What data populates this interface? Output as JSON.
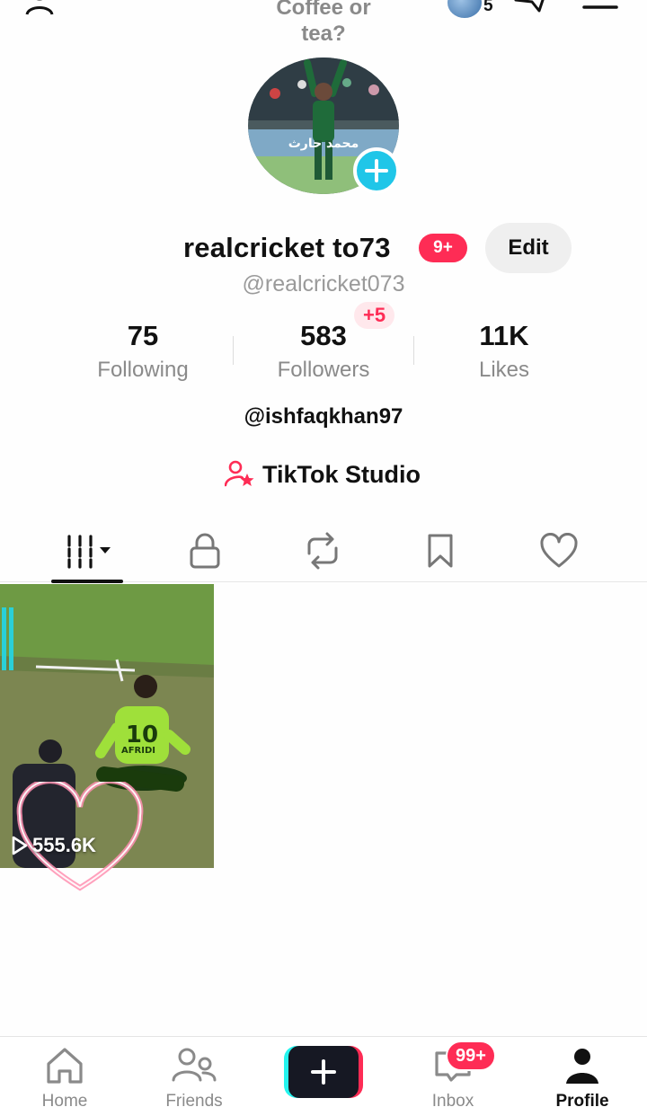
{
  "header": {
    "status_text": "Coffee or tea?",
    "story_count": "5"
  },
  "profile": {
    "display_name": "realcricket to73",
    "notification_badge": "9+",
    "edit_label": "Edit",
    "username": "@realcricket073",
    "avatar_caption": "محمد حارث"
  },
  "stats": {
    "following": {
      "value": "75",
      "label": "Following"
    },
    "followers": {
      "value": "583",
      "label": "Followers",
      "delta": "+5"
    },
    "likes": {
      "value": "11K",
      "label": "Likes"
    }
  },
  "bio": {
    "mention": "@ishfaqkhan97",
    "studio_label": "TikTok Studio"
  },
  "tabs": [
    {
      "icon": "grid-icon",
      "active": true
    },
    {
      "icon": "lock-icon",
      "active": false
    },
    {
      "icon": "repost-icon",
      "active": false
    },
    {
      "icon": "bookmark-icon",
      "active": false
    },
    {
      "icon": "heart-icon",
      "active": false
    }
  ],
  "videos": [
    {
      "views": "555.6K",
      "jersey": "10",
      "jersey_name": "AFRIDI"
    }
  ],
  "bottom_nav": {
    "home": "Home",
    "friends": "Friends",
    "inbox": "Inbox",
    "inbox_badge": "99+",
    "profile": "Profile"
  },
  "colors": {
    "accent": "#fe2c55",
    "cyan": "#25f4ee",
    "avatar_add": "#20c6e8"
  }
}
